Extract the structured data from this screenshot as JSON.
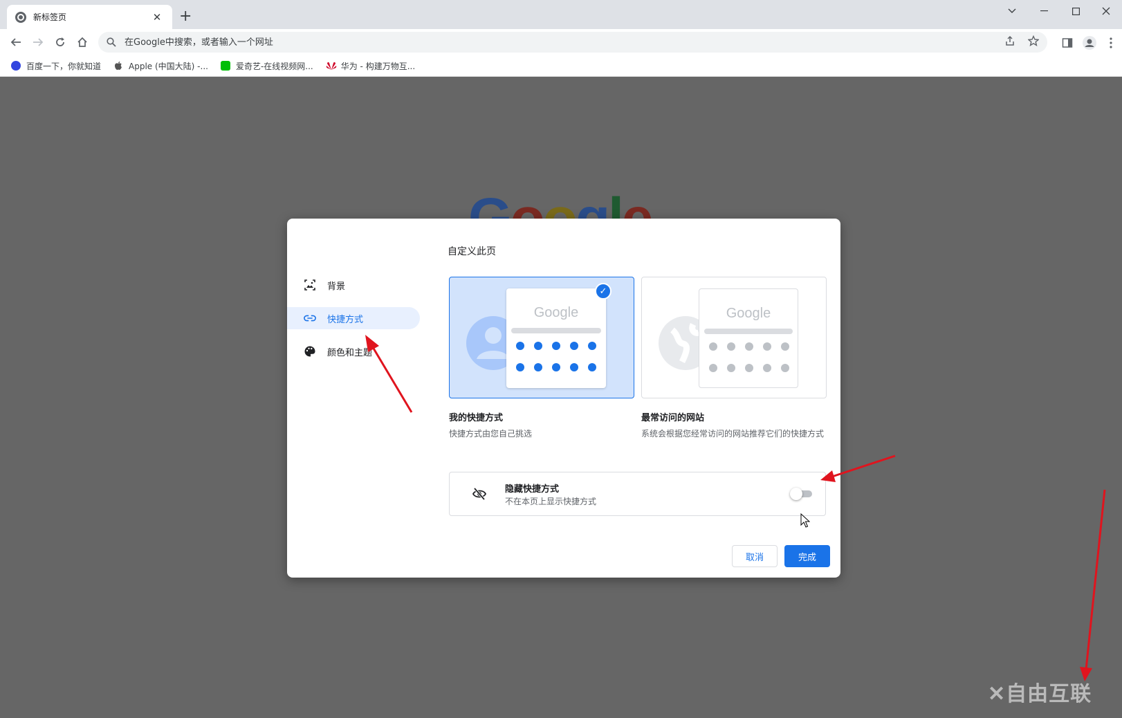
{
  "browser": {
    "tab_title": "新标签页",
    "tab_close": "✕",
    "new_tab": "+",
    "omnibox_placeholder": "在Google中搜索，或者输入一个网址",
    "bookmarks": [
      {
        "label": "百度一下，你就知道",
        "icon": "baidu-icon",
        "color": "#3245df"
      },
      {
        "label": "Apple (中国大陆) -...",
        "icon": "apple-icon",
        "color": "#555555"
      },
      {
        "label": "爱奇艺-在线视频网...",
        "icon": "iqiyi-icon",
        "color": "#00be06"
      },
      {
        "label": "华为 - 构建万物互...",
        "icon": "huawei-icon",
        "color": "#cf0a2c"
      }
    ]
  },
  "page": {
    "logo_letters": [
      "G",
      "o",
      "o",
      "g",
      "l",
      "e"
    ]
  },
  "dialog": {
    "title": "自定义此页",
    "nav": [
      {
        "label": "背景",
        "icon": "background-image-icon"
      },
      {
        "label": "快捷方式",
        "icon": "link-icon",
        "active": true
      },
      {
        "label": "颜色和主题",
        "icon": "palette-icon"
      }
    ],
    "cards": [
      {
        "title": "我的快捷方式",
        "desc": "快捷方式由您自己挑选",
        "preview_logo": "Google",
        "selected": true
      },
      {
        "title": "最常访问的网站",
        "desc": "系统会根据您经常访问的网站推荐它们的快捷方式",
        "preview_logo": "Google",
        "selected": false
      }
    ],
    "hide": {
      "title": "隐藏快捷方式",
      "desc": "不在本页上显示快捷方式",
      "enabled": false
    },
    "cancel": "取消",
    "done": "完成"
  },
  "colors": {
    "accent": "#1a73e8",
    "annotation_arrow": "#e0141e"
  }
}
